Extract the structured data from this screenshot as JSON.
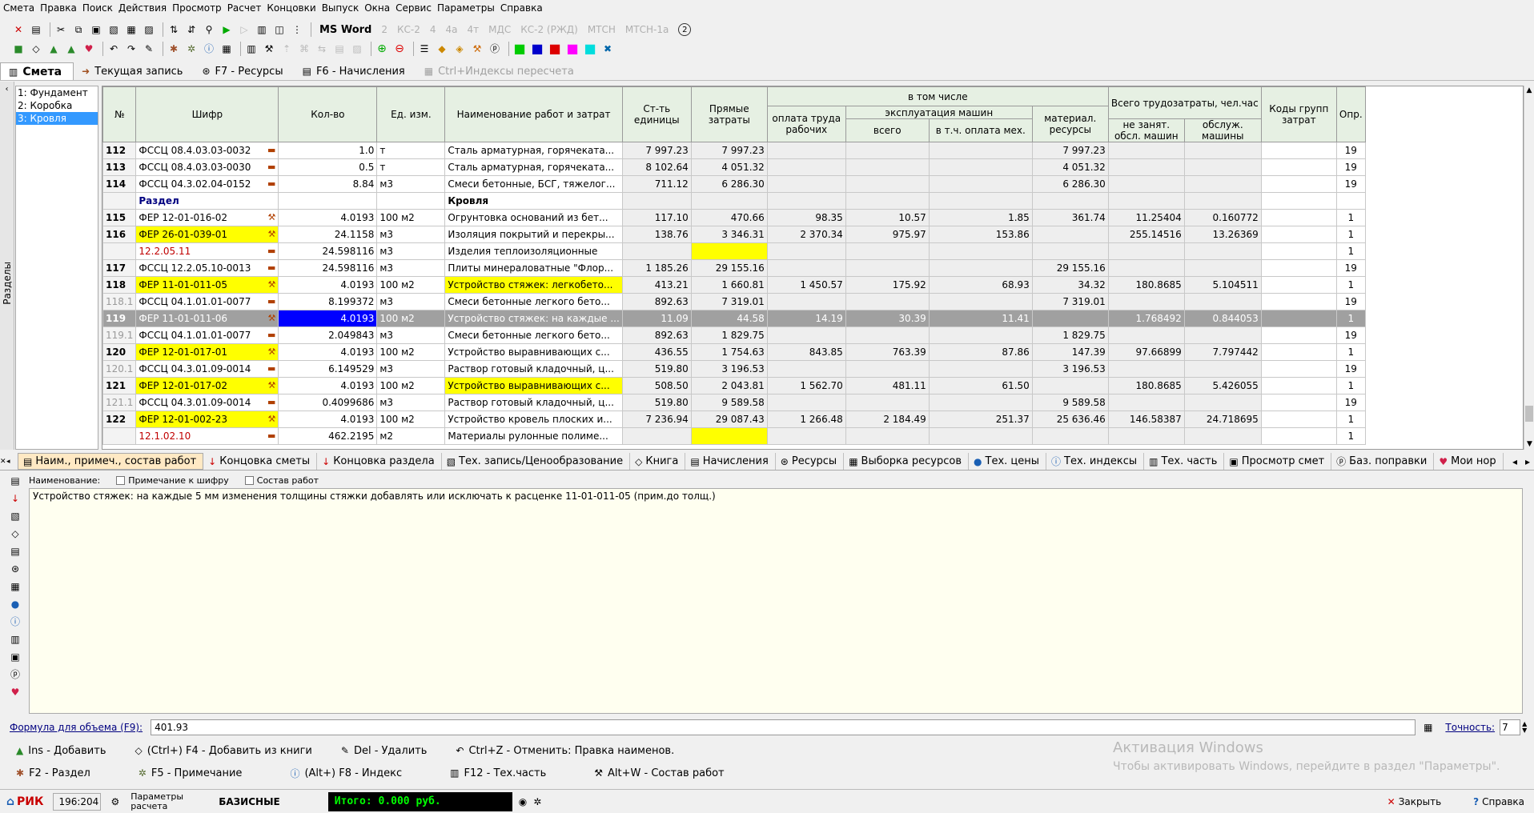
{
  "menu": [
    "Смета",
    "Правка",
    "Поиск",
    "Действия",
    "Просмотр",
    "Расчет",
    "Концовки",
    "Выпуск",
    "Окна",
    "Сервис",
    "Параметры",
    "Справка"
  ],
  "toolbar1": {
    "msword": "MS Word",
    "dim_items": [
      "2",
      "КС-2",
      "4",
      "4а",
      "4т",
      "МДС",
      "КС-2 (РЖД)",
      "МТСН",
      "МТСН-1а",
      "2"
    ]
  },
  "tabs": [
    {
      "label": "Смета",
      "icon": "book-icon",
      "active": true
    },
    {
      "label": "Текущая запись",
      "icon": "arrow-icon"
    },
    {
      "label": "F7 - Ресурсы",
      "icon": "resources-icon"
    },
    {
      "label": "F6 - Начисления",
      "icon": "calc-icon"
    },
    {
      "label": "Ctrl+Индексы пересчета",
      "icon": "index-icon",
      "disabled": true
    }
  ],
  "sidebar": {
    "label": "Разделы",
    "sections": [
      "1: Фундамент",
      "2: Коробка",
      "3: Кровля"
    ],
    "selected": 2
  },
  "grid": {
    "headers": {
      "no": "№",
      "code": "Шифр",
      "qty": "Кол-во",
      "unit": "Ед. изм.",
      "name": "Наименование работ и затрат",
      "unit_cost": "Ст-ть единицы",
      "direct": "Прямые затраты",
      "incl": "в том числе",
      "labor": "оплата труда рабочих",
      "machines": "эксплуатация машин",
      "m_total": "всего",
      "m_labor": "в т.ч. оплата мех.",
      "materials": "материал. ресурсы",
      "trud": "Всего трудозатраты, чел.час",
      "trud_w": "не занят. обсл. машин",
      "trud_m": "обслуж. машины",
      "codes": "Коды групп затрат",
      "opr": "Опр."
    },
    "rows": [
      {
        "no": "112",
        "code": "ФССЦ 08.4.03.03-0032",
        "qty": "1.0",
        "unit": "т",
        "name": "Сталь арматурная, горячеката...",
        "uc": "7 997.23",
        "dz": "7 997.23",
        "ot": "",
        "em": "",
        "om": "",
        "mr": "7 997.23",
        "t1": "",
        "t2": "",
        "kg": "",
        "op": "19"
      },
      {
        "no": "113",
        "code": "ФССЦ 08.4.03.03-0030",
        "qty": "0.5",
        "unit": "т",
        "name": "Сталь арматурная, горячеката...",
        "uc": "8 102.64",
        "dz": "4 051.32",
        "ot": "",
        "em": "",
        "om": "",
        "mr": "4 051.32",
        "t1": "",
        "t2": "",
        "kg": "",
        "op": "19"
      },
      {
        "no": "114",
        "code": "ФССЦ 04.3.02.04-0152",
        "qty": "8.84",
        "unit": "м3",
        "name": "Смеси бетонные, БСГ, тяжелог...",
        "uc": "711.12",
        "dz": "6 286.30",
        "ot": "",
        "em": "",
        "om": "",
        "mr": "6 286.30",
        "t1": "",
        "t2": "",
        "kg": "",
        "op": "19"
      },
      {
        "type": "section",
        "code": "Раздел",
        "name": "Кровля"
      },
      {
        "no": "115",
        "code": "ФЕР 12-01-016-02",
        "qty": "4.0193",
        "unit": "100 м2",
        "name": "Огрунтовка оснований из бет...",
        "uc": "117.10",
        "dz": "470.66",
        "ot": "98.35",
        "em": "10.57",
        "om": "1.85",
        "mr": "361.74",
        "t1": "11.25404",
        "t2": "0.160772",
        "kg": "",
        "op": "1"
      },
      {
        "no": "116",
        "code": "ФЕР 26-01-039-01",
        "qty": "24.1158",
        "unit": "м3",
        "name": "Изоляция покрытий и перекры...",
        "uc": "138.76",
        "dz": "3 346.31",
        "ot": "2 370.34",
        "em": "975.97",
        "om": "153.86",
        "mr": "",
        "t1": "255.14516",
        "t2": "13.26369",
        "kg": "",
        "op": "1",
        "codeYellow": true
      },
      {
        "no": "",
        "code": "12.2.05.11",
        "qty": "24.598116",
        "unit": "м3",
        "name": "Изделия теплоизоляционные",
        "uc": "",
        "dz": "",
        "ot": "",
        "em": "",
        "om": "",
        "mr": "",
        "t1": "",
        "t2": "",
        "kg": "",
        "op": "1",
        "redCode": true,
        "dzYellow": true
      },
      {
        "no": "117",
        "code": "ФССЦ 12.2.05.10-0013",
        "qty": "24.598116",
        "unit": "м3",
        "name": "Плиты минераловатные \"Флор...",
        "uc": "1 185.26",
        "dz": "29 155.16",
        "ot": "",
        "em": "",
        "om": "",
        "mr": "29 155.16",
        "t1": "",
        "t2": "",
        "kg": "",
        "op": "19"
      },
      {
        "no": "118",
        "code": "ФЕР 11-01-011-05",
        "qty": "4.0193",
        "unit": "100 м2",
        "name": "Устройство стяжек: легкобето...",
        "uc": "413.21",
        "dz": "1 660.81",
        "ot": "1 450.57",
        "em": "175.92",
        "om": "68.93",
        "mr": "34.32",
        "t1": "180.8685",
        "t2": "5.104511",
        "kg": "",
        "op": "1",
        "codeYellow": true,
        "nameYellow": true
      },
      {
        "no": "118.1",
        "code": "ФССЦ 04.1.01.01-0077",
        "qty": "8.199372",
        "unit": "м3",
        "name": "Смеси бетонные легкого бето...",
        "uc": "892.63",
        "dz": "7 319.01",
        "ot": "",
        "em": "",
        "om": "",
        "mr": "7 319.01",
        "t1": "",
        "t2": "",
        "kg": "",
        "op": "19",
        "sub": true
      },
      {
        "no": "119",
        "code": "ФЕР 11-01-011-06",
        "qty": "4.0193",
        "unit": "100 м2",
        "name": "Устройство стяжек: на каждые ...",
        "uc": "11.09",
        "dz": "44.58",
        "ot": "14.19",
        "em": "30.39",
        "om": "11.41",
        "mr": "",
        "t1": "1.768492",
        "t2": "0.844053",
        "kg": "",
        "op": "1",
        "dark": true
      },
      {
        "no": "119.1",
        "code": "ФССЦ 04.1.01.01-0077",
        "qty": "2.049843",
        "unit": "м3",
        "name": "Смеси бетонные легкого бето...",
        "uc": "892.63",
        "dz": "1 829.75",
        "ot": "",
        "em": "",
        "om": "",
        "mr": "1 829.75",
        "t1": "",
        "t2": "",
        "kg": "",
        "op": "19",
        "sub": true
      },
      {
        "no": "120",
        "code": "ФЕР 12-01-017-01",
        "qty": "4.0193",
        "unit": "100 м2",
        "name": "Устройство выравнивающих с...",
        "uc": "436.55",
        "dz": "1 754.63",
        "ot": "843.85",
        "em": "763.39",
        "om": "87.86",
        "mr": "147.39",
        "t1": "97.66899",
        "t2": "7.797442",
        "kg": "",
        "op": "1",
        "codeYellow": true
      },
      {
        "no": "120.1",
        "code": "ФССЦ 04.3.01.09-0014",
        "qty": "6.149529",
        "unit": "м3",
        "name": "Раствор готовый кладочный, ц...",
        "uc": "519.80",
        "dz": "3 196.53",
        "ot": "",
        "em": "",
        "om": "",
        "mr": "3 196.53",
        "t1": "",
        "t2": "",
        "kg": "",
        "op": "19",
        "sub": true
      },
      {
        "no": "121",
        "code": "ФЕР 12-01-017-02",
        "qty": "4.0193",
        "unit": "100 м2",
        "name": "Устройство выравнивающих с...",
        "uc": "508.50",
        "dz": "2 043.81",
        "ot": "1 562.70",
        "em": "481.11",
        "om": "61.50",
        "mr": "",
        "t1": "180.8685",
        "t2": "5.426055",
        "kg": "",
        "op": "1",
        "codeYellow": true,
        "nameYellow": true
      },
      {
        "no": "121.1",
        "code": "ФССЦ 04.3.01.09-0014",
        "qty": "0.4099686",
        "unit": "м3",
        "name": "Раствор готовый кладочный, ц...",
        "uc": "519.80",
        "dz": "9 589.58",
        "ot": "",
        "em": "",
        "om": "",
        "mr": "9 589.58",
        "t1": "",
        "t2": "",
        "kg": "",
        "op": "19",
        "sub": true
      },
      {
        "no": "122",
        "code": "ФЕР 12-01-002-23",
        "qty": "4.0193",
        "unit": "100 м2",
        "name": "Устройство кровель плоских и...",
        "uc": "7 236.94",
        "dz": "29 087.43",
        "ot": "1 266.48",
        "em": "2 184.49",
        "om": "251.37",
        "mr": "25 636.46",
        "t1": "146.58387",
        "t2": "24.718695",
        "kg": "",
        "op": "1",
        "codeYellow": true
      },
      {
        "no": "",
        "code": "12.1.02.10",
        "qty": "462.2195",
        "unit": "м2",
        "name": "Материалы рулонные полиме...",
        "uc": "",
        "dz": "",
        "ot": "",
        "em": "",
        "om": "",
        "mr": "",
        "t1": "",
        "t2": "",
        "kg": "",
        "op": "1",
        "redCode": true,
        "dzYellow": true
      }
    ]
  },
  "bottom_tabs": [
    {
      "label": "Наим., примеч., состав работ",
      "active": true
    },
    {
      "label": "Концовка сметы"
    },
    {
      "label": "Концовка раздела"
    },
    {
      "label": "Тех. запись/Ценообразование"
    },
    {
      "label": "Книга"
    },
    {
      "label": "Начисления"
    },
    {
      "label": "Ресурсы"
    },
    {
      "label": "Выборка ресурсов"
    },
    {
      "label": "Тех. цены"
    },
    {
      "label": "Тех. индексы"
    },
    {
      "label": "Тех. часть"
    },
    {
      "label": "Просмотр смет"
    },
    {
      "label": "Баз. поправки"
    },
    {
      "label": "Мои нор"
    }
  ],
  "name_panel": {
    "label": "Наименование:",
    "cb1": "Примечание к шифру",
    "cb2": "Состав работ",
    "text": "Устройство стяжек: на каждые 5 мм изменения толщины стяжки добавлять или исключать к расценке 11-01-011-05 (прим.до толщ.)"
  },
  "formula": {
    "label": "Формула для объема (F9):",
    "value": "401.93",
    "precision_label": "Точность:",
    "precision": "7"
  },
  "hotkeys1": [
    "Ins - Добавить",
    "(Ctrl+) F4 - Добавить из книги",
    "Del - Удалить",
    "Ctrl+Z - Отменить: Правка наименов."
  ],
  "hotkeys2": [
    "F2 - Раздел",
    "F5 - Примечание",
    "(Alt+) F8 - Индекс",
    "F12 - Тех.часть",
    "Alt+W - Состав работ"
  ],
  "watermark": {
    "line1": "Активация Windows",
    "line2": "Чтобы активировать Windows, перейдите в раздел \"Параметры\"."
  },
  "status": {
    "logo": "РИК",
    "pos": "196:204",
    "params": "Параметры расчета",
    "mode": "БАЗИСНЫЕ",
    "total": "Итого: 0.000 руб.",
    "close": "Закрыть",
    "help": "Справка"
  }
}
